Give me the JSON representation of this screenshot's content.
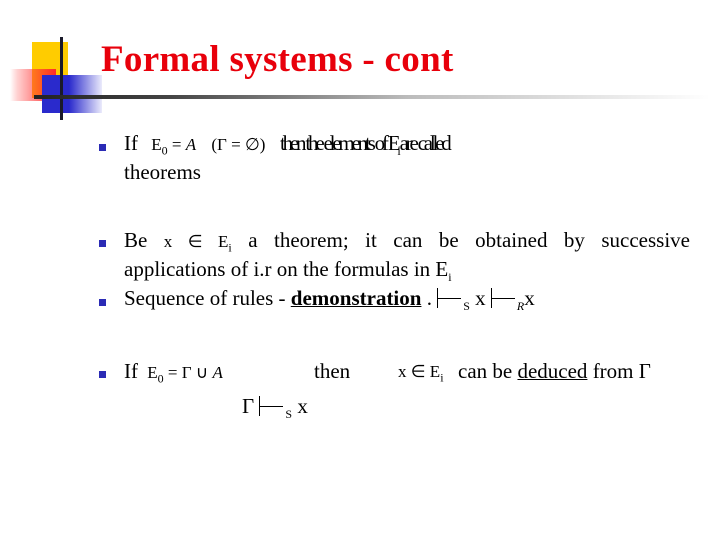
{
  "slide": {
    "title": "Formal systems - cont",
    "logo_icon": "decorative-squares-logo",
    "colors": {
      "title": "#e8000b",
      "bullet": "#2b2bb5",
      "logo_yellow": "#ffcc00",
      "logo_red": "#ff2a2a",
      "logo_blue": "#2a2acc"
    },
    "bullets": [
      {
        "prefix": "If",
        "formula1": "E",
        "formula1_sub": "0",
        "formula1_rest": " = ",
        "formula1_var": "A",
        "formula2": "(Γ = ∅)",
        "overlapped_text": "then the elements of E",
        "overlapped_sub": "i",
        "overlapped_tail": " are called",
        "line2": "theorems"
      },
      {
        "prefix": "Be",
        "formula": "x ∈ E",
        "formula_sub": "i",
        "text": "a theorem; it can be obtained by successive",
        "line2": "applications of i.r on the formulas in E",
        "line2_sub": "i"
      },
      {
        "text": "Sequence of rules - ",
        "bold_underlined": "demonstration",
        "after": " . ",
        "sub1": "S",
        "x1": "x",
        "sub2": "R",
        "x2": "x"
      },
      {
        "prefix": "If",
        "formula1": "E",
        "formula1_sub": "0",
        "formula1_rest": " = Γ ∪ ",
        "formula1_var": "A",
        "then": "then",
        "formula2": "x ∈ E",
        "formula2_sub": "i",
        "text_before": "can be ",
        "underlined": "deduced",
        "text_after": " from Γ",
        "line2_gamma": "Γ",
        "line2_sub": "S",
        "line2_x": "x"
      }
    ]
  }
}
